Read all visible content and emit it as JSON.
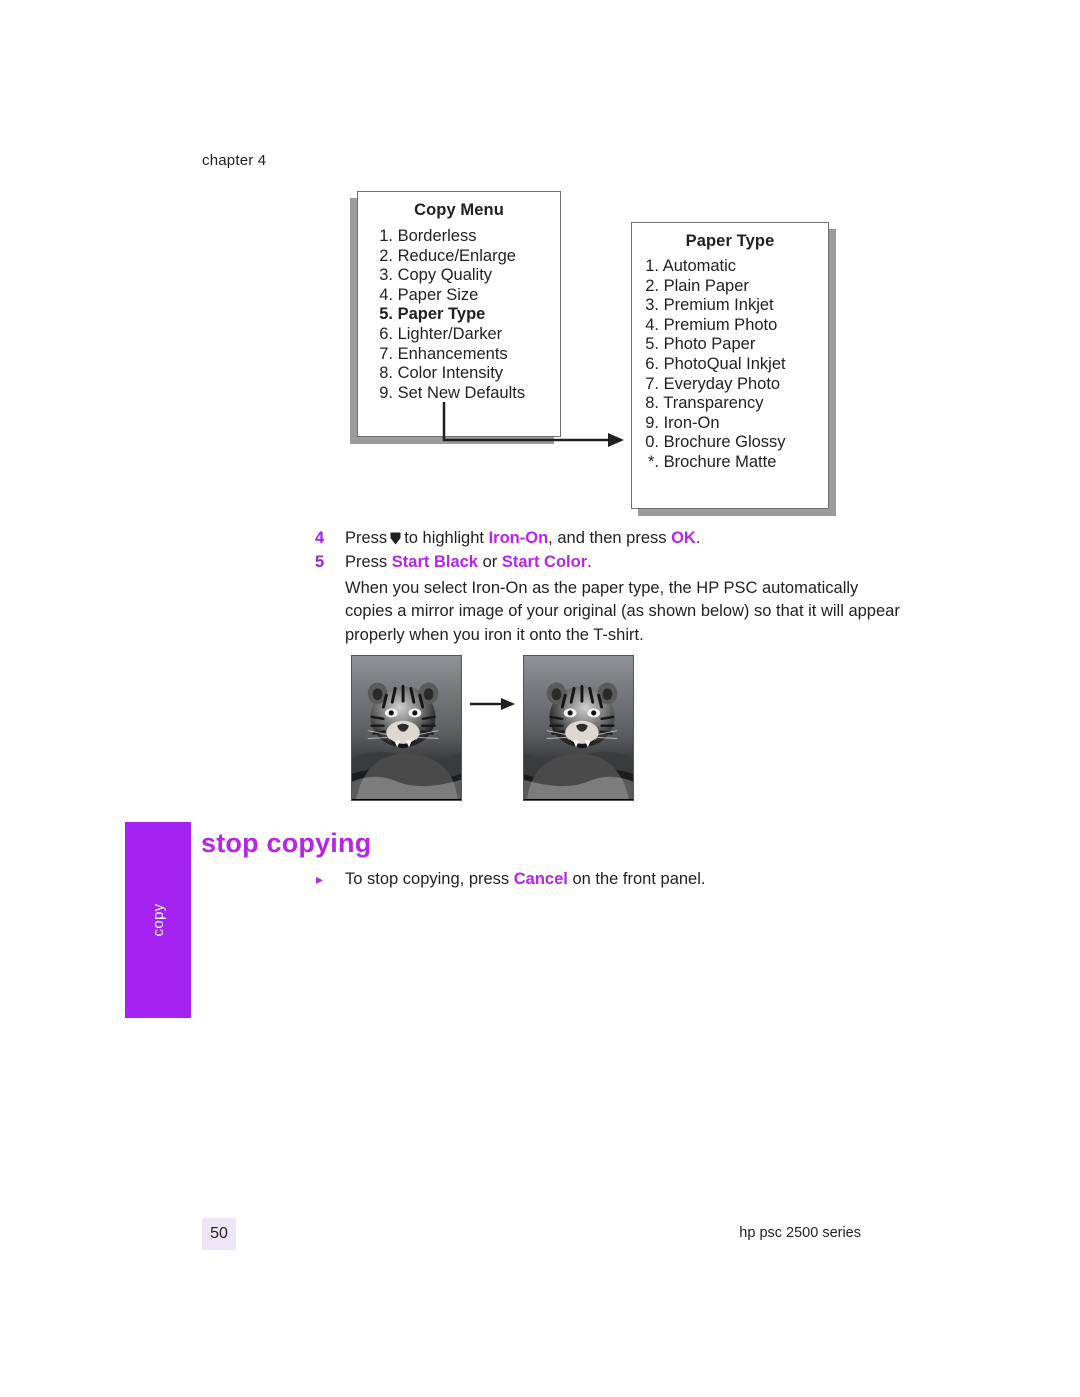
{
  "header": {
    "chapter": "chapter 4"
  },
  "copy_menu": {
    "title": "Copy Menu",
    "items": [
      {
        "num": "1.",
        "label": "Borderless",
        "selected": false
      },
      {
        "num": "2.",
        "label": "Reduce/Enlarge",
        "selected": false
      },
      {
        "num": "3.",
        "label": "Copy Quality",
        "selected": false
      },
      {
        "num": "4.",
        "label": "Paper Size",
        "selected": false
      },
      {
        "num": "5.",
        "label": "Paper Type",
        "selected": true
      },
      {
        "num": "6.",
        "label": "Lighter/Darker",
        "selected": false
      },
      {
        "num": "7.",
        "label": "Enhancements",
        "selected": false
      },
      {
        "num": "8.",
        "label": "Color Intensity",
        "selected": false
      },
      {
        "num": "9.",
        "label": "Set New Defaults",
        "selected": false
      }
    ]
  },
  "paper_type_menu": {
    "title": "Paper Type",
    "items": [
      {
        "num": "1.",
        "label": "Automatic",
        "selected": false
      },
      {
        "num": "2.",
        "label": "Plain Paper",
        "selected": false
      },
      {
        "num": "3.",
        "label": "Premium Inkjet",
        "selected": false
      },
      {
        "num": "4.",
        "label": "Premium Photo",
        "selected": false
      },
      {
        "num": "5.",
        "label": "Photo Paper",
        "selected": false
      },
      {
        "num": "6.",
        "label": "PhotoQual Inkjet",
        "selected": false
      },
      {
        "num": "7.",
        "label": "Everyday Photo",
        "selected": false
      },
      {
        "num": "8.",
        "label": "Transparency",
        "selected": false
      },
      {
        "num": "9.",
        "label": "Iron-On",
        "selected": false
      },
      {
        "num": "0.",
        "label": "Brochure Glossy",
        "selected": false
      },
      {
        "num": "*.",
        "label": "Brochure Matte",
        "selected": false
      }
    ]
  },
  "steps": [
    {
      "number": "4",
      "pre": "Press",
      "mid": "to highlight",
      "highlight1": "Iron-On",
      "post": ", and then press",
      "highlight2": "OK",
      "end": "."
    },
    {
      "number": "5",
      "pre": "Press",
      "highlight1": "Start Black",
      "mid": "or",
      "highlight2": "Start Color",
      "end": "."
    }
  ],
  "body_paragraph": "When you select Iron-On as the paper type, the HP PSC automatically copies a mirror image of your original (as shown below) so that it will appear properly when you iron it onto the T-shirt.",
  "section": {
    "heading": "stop copying",
    "bullet": {
      "pre": "To stop copying, press",
      "highlight": "Cancel",
      "post": "on the front panel."
    }
  },
  "side_tab": {
    "label": "copy",
    "color": "#a423f0"
  },
  "footer": {
    "page_number": "50",
    "product": "hp psc 2500 series"
  },
  "images": {
    "left_caption": "tiger-original",
    "right_caption": "tiger-mirrored"
  },
  "colors": {
    "accent": "#b625e8",
    "text": "#231f20",
    "page_box": "#ece6f7"
  }
}
